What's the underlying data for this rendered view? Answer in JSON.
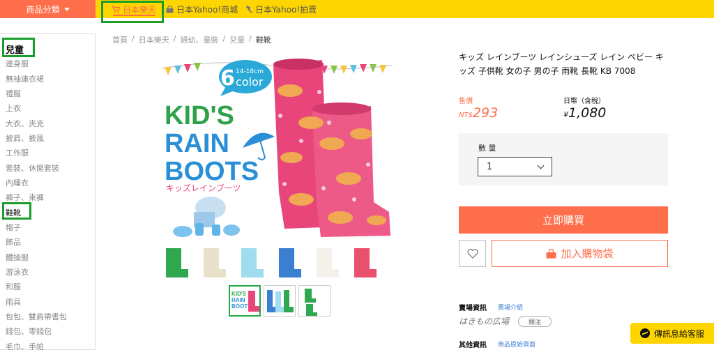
{
  "topbar": {
    "category_button": "商品分類",
    "tabs": [
      {
        "label": "日本樂天",
        "icon": "cart-icon"
      },
      {
        "label": "日本Yahoo!商城",
        "icon": "bag-icon"
      },
      {
        "label": "日本Yahoo!拍賣",
        "icon": "hammer-icon"
      }
    ]
  },
  "sidebar": {
    "title": "兒童",
    "items": [
      "連身服",
      "無袖連衣裙",
      "禮服",
      "上衣",
      "大衣、夾克",
      "披肩、披風",
      "工作服",
      "套裝、休閒套裝",
      "內睡衣",
      "褲子、束褲",
      "鞋靴",
      "帽子",
      "飾品",
      "體操服",
      "游泳衣",
      "和服",
      "雨具",
      "包包、雙肩帶書包",
      "錢包、零錢包",
      "毛巾、手帕"
    ],
    "current": "鞋靴"
  },
  "breadcrumb": [
    "首頁",
    "日本樂天",
    "婦幼、童裝",
    "兒童",
    "鞋靴"
  ],
  "product_image": {
    "badge_number": "6",
    "badge_range": "14-18cm",
    "badge_word": "color",
    "headline": [
      "KID'S",
      "RAIN",
      "BOOTS"
    ],
    "subtitle": "キッズレインブーツ",
    "boot_colors": [
      "#2fa84f",
      "#e8e0c8",
      "#9fdcef",
      "#3a7fd0",
      "#f4f0ea",
      "#e8506e"
    ],
    "main_boot_color": "#e8467a",
    "thumb_text": [
      "KID'S",
      "RAIN",
      "BOOTS"
    ]
  },
  "product": {
    "title": "キッズ レインブーツ レインシューズ レイン ベビー キッズ 子供靴 女の子 男の子 雨靴 長靴 KB 7008",
    "price_label": "售價",
    "price_currency": "NT$",
    "price_value": "293",
    "yen_label": "日幣（含稅）",
    "yen_currency": "¥",
    "yen_value": "1,080",
    "qty_label": "數 量",
    "qty_value": "1",
    "buy_label": "立即購買",
    "cart_label": "加入購物袋",
    "shop_label": "賣場資訊",
    "shop_link": "賣場介紹",
    "shop_name": "はきもの広場",
    "follow_label": "關注",
    "other_label": "其他資訊",
    "other_link": "商品原始頁面",
    "chat_label": "傳訊息給客服"
  },
  "colors": {
    "topbar": "#ffd500",
    "accent": "#ff6e4a",
    "highlight_box": "#1a9d2a",
    "link": "#3b7fd4"
  }
}
